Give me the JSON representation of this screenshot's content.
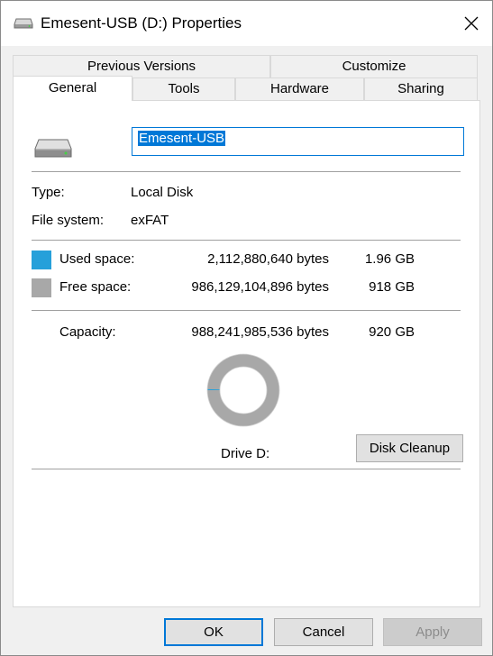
{
  "window": {
    "title": "Emesent-USB (D:) Properties"
  },
  "tabs": {
    "row1": [
      {
        "label": "Previous Versions"
      },
      {
        "label": "Customize"
      }
    ],
    "row2": [
      {
        "label": "General",
        "active": true
      },
      {
        "label": "Tools"
      },
      {
        "label": "Hardware"
      },
      {
        "label": "Sharing"
      }
    ]
  },
  "general": {
    "volume_name": "Emesent-USB",
    "type_label": "Type:",
    "type_value": "Local Disk",
    "fs_label": "File system:",
    "fs_value": "exFAT",
    "used_label": "Used space:",
    "used_bytes": "2,112,880,640 bytes",
    "used_size": "1.96 GB",
    "free_label": "Free space:",
    "free_bytes": "986,129,104,896 bytes",
    "free_size": "918 GB",
    "capacity_label": "Capacity:",
    "capacity_bytes": "988,241,985,536 bytes",
    "capacity_size": "920 GB",
    "drive_label": "Drive D:",
    "used_fraction": 0.0021,
    "cleanup_label": "Disk Cleanup"
  },
  "colors": {
    "used": "#26a0da",
    "free": "#a8a8a8",
    "accent": "#0078d7"
  },
  "buttons": {
    "ok": "OK",
    "cancel": "Cancel",
    "apply": "Apply"
  },
  "icons": {
    "title": "drive-icon",
    "close": "close-icon",
    "drive": "drive-icon"
  }
}
